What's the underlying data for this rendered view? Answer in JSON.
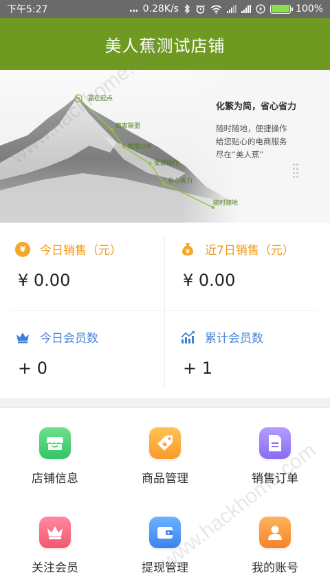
{
  "status_bar": {
    "time": "下午5:27",
    "dots": "...",
    "net_speed": "0.28K/s",
    "battery": "100%",
    "battery_level": 1.0
  },
  "header": {
    "title": "美人蕉测试店铺"
  },
  "banner": {
    "route": [
      "赢在起点",
      "商家联盟",
      "数据分析",
      "便捷操作",
      "省心省力",
      "随时随地"
    ],
    "slogan": "化繁为简，省心省力",
    "desc_lines": [
      "随时随地，便捷操作",
      "给您贴心的电商服务",
      "尽在“美人蕉”"
    ]
  },
  "stats": [
    {
      "label": "今日销售（元）",
      "value": "¥ 0.00",
      "icon": "yen-coin-icon",
      "color": "#f09a1a"
    },
    {
      "label": "近7日销售（元）",
      "value": "¥ 0.00",
      "icon": "money-bag-icon",
      "color": "#f09a1a"
    },
    {
      "label": "今日会员数",
      "value": "+ 0",
      "icon": "crown-icon",
      "color": "#4a86d8"
    },
    {
      "label": "累计会员数",
      "value": "+ 1",
      "icon": "trend-chart-icon",
      "color": "#4a86d8"
    }
  ],
  "menu": [
    {
      "label": "店铺信息",
      "icon": "store-icon",
      "color_top": "#6fe08e",
      "color_bottom": "#34c466"
    },
    {
      "label": "商品管理",
      "icon": "tag-icon",
      "color_top": "#ffc252",
      "color_bottom": "#f89a2b"
    },
    {
      "label": "销售订单",
      "icon": "document-icon",
      "color_top": "#b59cff",
      "color_bottom": "#8a6cf0"
    },
    {
      "label": "关注会员",
      "icon": "crown-icon",
      "color_top": "#ff8aa0",
      "color_bottom": "#f2576f"
    },
    {
      "label": "提现管理",
      "icon": "wallet-icon",
      "color_top": "#6fb2ff",
      "color_bottom": "#3b82f0"
    },
    {
      "label": "我的账号",
      "icon": "user-icon",
      "color_top": "#ffb35c",
      "color_bottom": "#f5842b"
    }
  ],
  "watermark": "www.hackhome.com"
}
